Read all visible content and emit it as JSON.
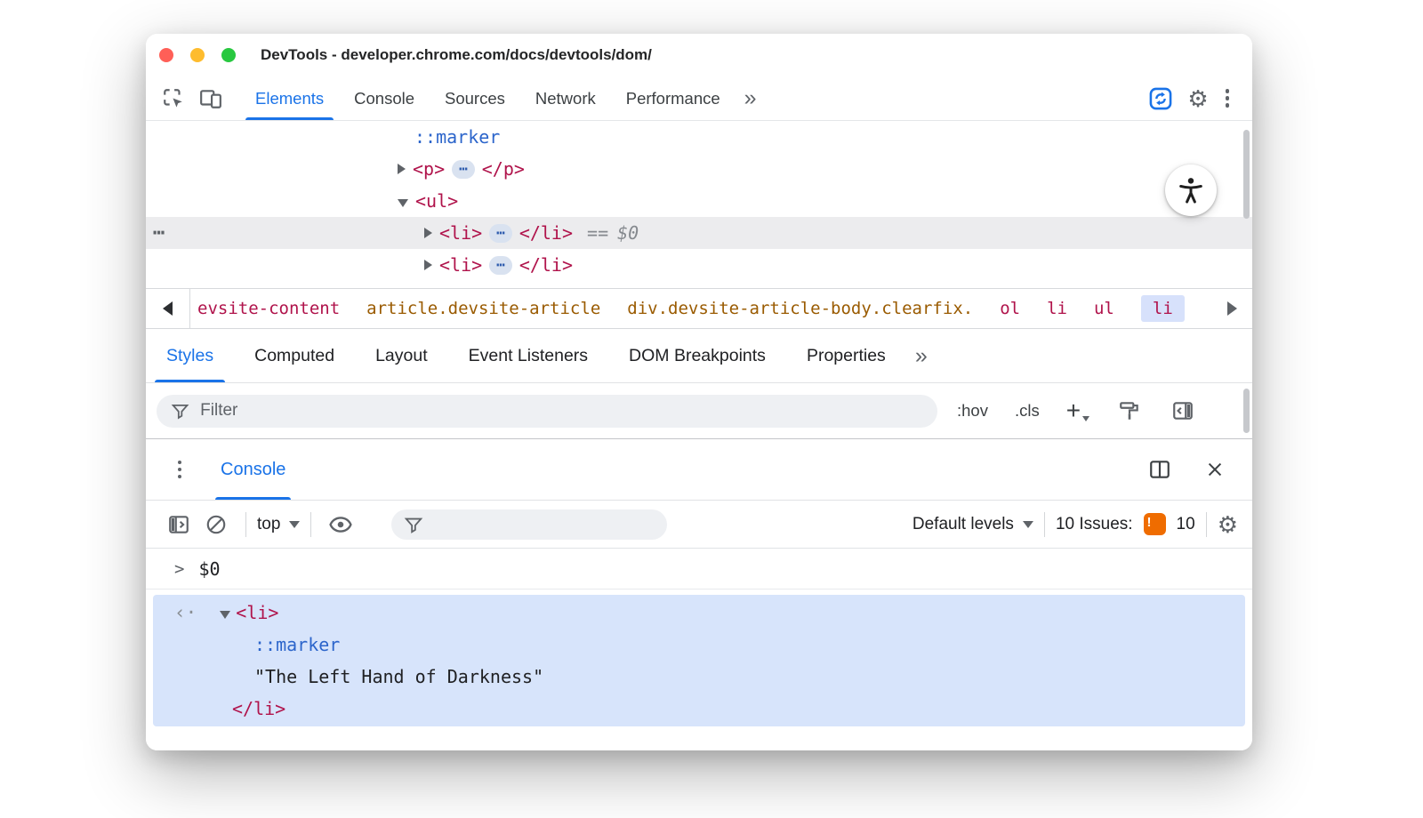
{
  "colors": {
    "accent": "#1a73e8",
    "tag": "#b0134b",
    "attr": "#9a5b01",
    "pseudo": "#2c65cb",
    "selection_blue": "#d7e4fb",
    "crumb_selected_bg": "#d7e1fb",
    "issues_badge": "#ef6c00",
    "light_red": "#ff5f57",
    "light_yellow": "#febc2e",
    "light_green": "#28c840"
  },
  "titlebar": {
    "title": "DevTools - developer.chrome.com/docs/devtools/dom/"
  },
  "toolbar": {
    "tabs": [
      "Elements",
      "Console",
      "Sources",
      "Network",
      "Performance"
    ],
    "more_glyph": "»"
  },
  "icons": {
    "gear_glyph": "⚙"
  },
  "elements_tree": {
    "pseudo_marker": "::marker",
    "p_open": "<p>",
    "p_close": "</p>",
    "ul_open": "<ul>",
    "li_open": "<li>",
    "li_close": "</li>",
    "ellipsis_glyph": "⋯",
    "more_actions_glyph": "⋯",
    "selected_equals": "==",
    "selected_var": "$0"
  },
  "breadcrumb": {
    "items": [
      "evsite-content",
      "article.devsite-article",
      "div.devsite-article-body.clearfix.",
      "ol",
      "li",
      "ul",
      "li"
    ]
  },
  "styles_pane": {
    "tabs": [
      "Styles",
      "Computed",
      "Layout",
      "Event Listeners",
      "DOM Breakpoints",
      "Properties"
    ],
    "more_glyph": "»",
    "filter_placeholder": "Filter",
    "pseudo_state_button": ":hov",
    "class_button": ".cls",
    "new_rule_button": "+"
  },
  "console": {
    "tab_label": "Console",
    "context_selector": "top",
    "levels_selector": "Default levels",
    "issues_label": "10 Issues:",
    "issues_badge_glyph": "!",
    "issues_count": "10",
    "prompt_chevron": ">",
    "prompt_expression": "$0",
    "returned_glyph": "‹·",
    "result": {
      "li_open": "<li>",
      "pseudo_marker": "::marker",
      "text_node": "\"The Left Hand of Darkness\"",
      "li_close": "</li>"
    }
  }
}
